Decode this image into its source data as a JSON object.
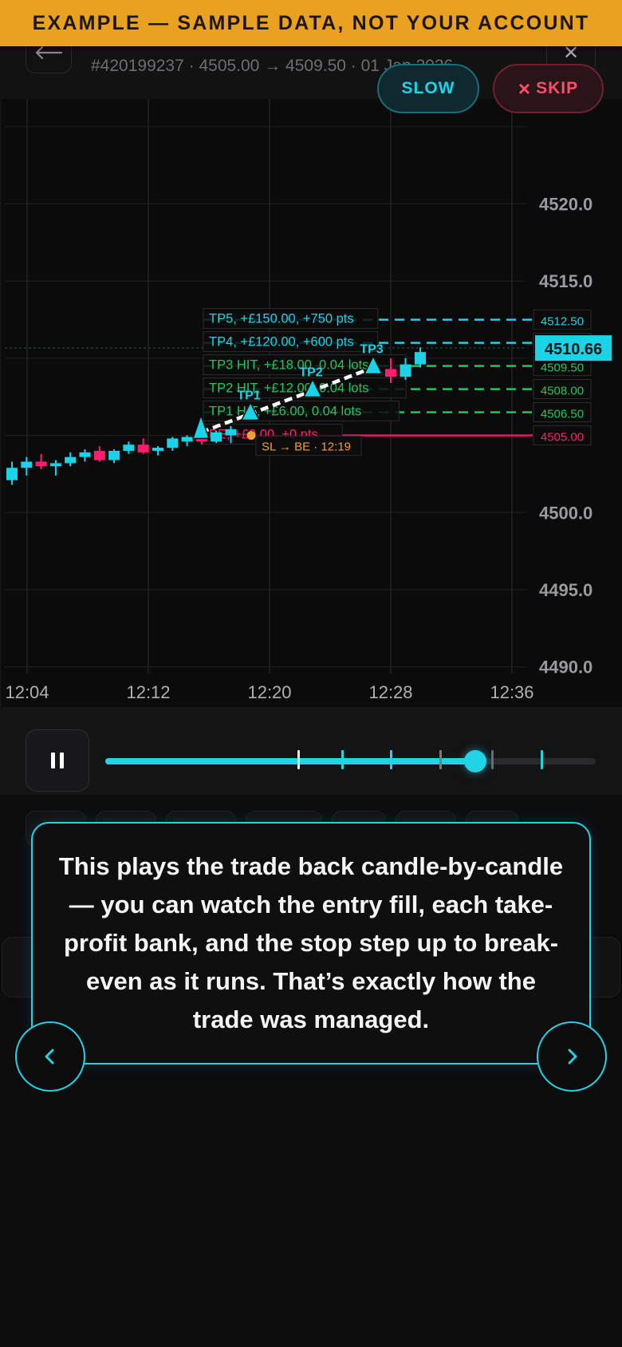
{
  "banner": {
    "text": "EXAMPLE — SAMPLE DATA, NOT YOUR ACCOUNT"
  },
  "header": {
    "subtitle": "#420199237 · 4505.00 → 4509.50 · 01 Jan 2026",
    "close_icon": "close-icon",
    "back_icon": "arrow-left-icon"
  },
  "controls": {
    "slow_label": "SLOW",
    "skip_label": "SKIP",
    "skip_icon": "×"
  },
  "chart_data": {
    "type": "candlestick",
    "x_ticks": [
      "12:04",
      "12:12",
      "12:20",
      "12:28",
      "12:36"
    ],
    "y_ticks": [
      "4520.0",
      "4515.0",
      "4500.0",
      "4495.0",
      "4490.0"
    ],
    "ylim": [
      4487.4,
      4526.8
    ],
    "current_price": "4510.66",
    "colors": {
      "up": "#19d3e6",
      "down": "#ff1e6e",
      "tp_hit": "#22c55e",
      "tp_open": "#19d3e6",
      "be": "#ff1e6e",
      "sl_label": "#f0a030"
    },
    "candles": [
      {
        "o": 4502.1,
        "h": 4503.3,
        "l": 4501.8,
        "c": 4502.9
      },
      {
        "o": 4502.9,
        "h": 4503.6,
        "l": 4502.4,
        "c": 4503.3
      },
      {
        "o": 4503.3,
        "h": 4503.8,
        "l": 4502.8,
        "c": 4503.0
      },
      {
        "o": 4503.0,
        "h": 4503.4,
        "l": 4502.4,
        "c": 4503.2
      },
      {
        "o": 4503.2,
        "h": 4503.9,
        "l": 4503.0,
        "c": 4503.6
      },
      {
        "o": 4503.6,
        "h": 4504.1,
        "l": 4503.3,
        "c": 4503.9
      },
      {
        "o": 4504.0,
        "h": 4504.3,
        "l": 4503.3,
        "c": 4503.4
      },
      {
        "o": 4503.4,
        "h": 4504.1,
        "l": 4503.2,
        "c": 4504.0
      },
      {
        "o": 4504.0,
        "h": 4504.6,
        "l": 4503.8,
        "c": 4504.4
      },
      {
        "o": 4504.4,
        "h": 4504.8,
        "l": 4503.8,
        "c": 4503.9
      },
      {
        "o": 4504.0,
        "h": 4504.3,
        "l": 4503.7,
        "c": 4504.2
      },
      {
        "o": 4504.2,
        "h": 4504.9,
        "l": 4504.0,
        "c": 4504.8
      },
      {
        "o": 4504.6,
        "h": 4505.0,
        "l": 4504.3,
        "c": 4504.9
      },
      {
        "o": 4505.1,
        "h": 4505.6,
        "l": 4504.4,
        "c": 4504.6
      },
      {
        "o": 4504.6,
        "h": 4505.3,
        "l": 4504.5,
        "c": 4505.2
      },
      {
        "o": 4505.0,
        "h": 4505.6,
        "l": 4504.5,
        "c": 4505.4
      },
      {
        "o": 4509.3,
        "h": 4510.0,
        "l": 4508.4,
        "c": 4508.8
      },
      {
        "o": 4508.8,
        "h": 4510.0,
        "l": 4508.6,
        "c": 4509.6
      },
      {
        "o": 4509.6,
        "h": 4510.7,
        "l": 4509.4,
        "c": 4510.4
      }
    ],
    "levels": [
      {
        "label": "TP5, +£150.00, +750 pts",
        "price": "4512.50",
        "status": "open"
      },
      {
        "label": "TP4, +£120.00, +600 pts",
        "price": "4511.00",
        "status": "open"
      },
      {
        "label": "TP3 HIT, +£18.00, 0.04 lots",
        "price": "4509.50",
        "status": "hit"
      },
      {
        "label": "TP2 HIT, +£12.00, 0.04 lots",
        "price": "4508.00",
        "status": "hit"
      },
      {
        "label": "TP1 HIT, +£6.00, 0.04 lots",
        "price": "4506.50",
        "status": "hit"
      },
      {
        "label": "BE, +£0.00, +0 pts",
        "price": "4505.00",
        "status": "be"
      }
    ],
    "markers": [
      {
        "label": "TP1",
        "time": "12:18",
        "price": "4506.5"
      },
      {
        "label": "TP2",
        "time": "12:23",
        "price": "4508.0"
      },
      {
        "label": "TP3",
        "time": "12:27",
        "price": "4509.5"
      }
    ],
    "sl_label": "SL → BE · 12:19"
  },
  "playback": {
    "pause_icon": "pause-icon",
    "progress": 0.755,
    "event_ticks": [
      0.395,
      0.483,
      0.583,
      0.683,
      0.79,
      0.89
    ]
  },
  "tooltip": {
    "text": "This plays the trade back candle-by-candle — you can watch the entry fill, each take-profit bank, and the stop step up to break-even as it runs. That’s exactly how the trade was managed.",
    "prev_icon": "chevron-left-icon",
    "next_icon": "chevron-right-icon"
  }
}
